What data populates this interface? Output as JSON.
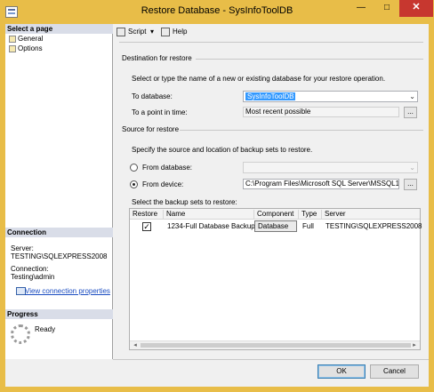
{
  "window": {
    "title": "Restore Database - SysInfoToolDB",
    "minimize_glyph": "—",
    "maximize_glyph": "□",
    "close_glyph": "✕"
  },
  "left": {
    "select_page_header": "Select a page",
    "pages": [
      "General",
      "Options"
    ],
    "connection_header": "Connection",
    "server_label": "Server:",
    "server_value": "TESTING\\SQLEXPRESS2008",
    "connection_label": "Connection:",
    "connection_value": "Testing\\admin",
    "view_connection_link": "View connection properties",
    "progress_header": "Progress",
    "progress_status": "Ready"
  },
  "toolbar": {
    "script_label": "Script",
    "script_arrow": "▾",
    "help_label": "Help"
  },
  "destination": {
    "group_label": "Destination for restore",
    "instructions": "Select or type the name of a new or existing database for your restore operation.",
    "to_database_label": "To database:",
    "to_database_value": "SysInfoToolDB",
    "point_in_time_label": "To a point in time:",
    "point_in_time_value": "Most recent possible",
    "browse_label": "..."
  },
  "source": {
    "group_label": "Source for restore",
    "instructions": "Specify the source and location of backup sets to restore.",
    "from_database_label": "From database:",
    "from_database_value": "",
    "from_device_label": "From device:",
    "from_device_value": "C:\\Program Files\\Microsoft SQL Server\\MSSQL10_5",
    "selected_option": "From device",
    "browse_label": "...",
    "backup_sets_label": "Select the backup sets to restore:"
  },
  "backup_grid": {
    "columns": [
      "Restore",
      "Name",
      "Component",
      "Type",
      "Server"
    ],
    "rows": [
      {
        "restore": true,
        "restore_glyph": "✓",
        "name": "1234-Full Database Backup",
        "component": "Database",
        "type": "Full",
        "server": "TESTING\\SQLEXPRESS2008"
      }
    ],
    "scroll_left": "◂",
    "scroll_right": "▸"
  },
  "buttons": {
    "ok": "OK",
    "cancel": "Cancel"
  },
  "icons": {
    "app": "restore-database-icon",
    "page": "page-icon",
    "script": "script-icon",
    "help": "help-icon",
    "connection": "connection-properties-icon",
    "progress": "progress-spinner-icon"
  },
  "colors": {
    "title_bar": "#e8bd48",
    "close_button": "#c7372f",
    "section_header": "#d9dde8",
    "selection": "#3399ff",
    "link": "#1a4cc0"
  }
}
